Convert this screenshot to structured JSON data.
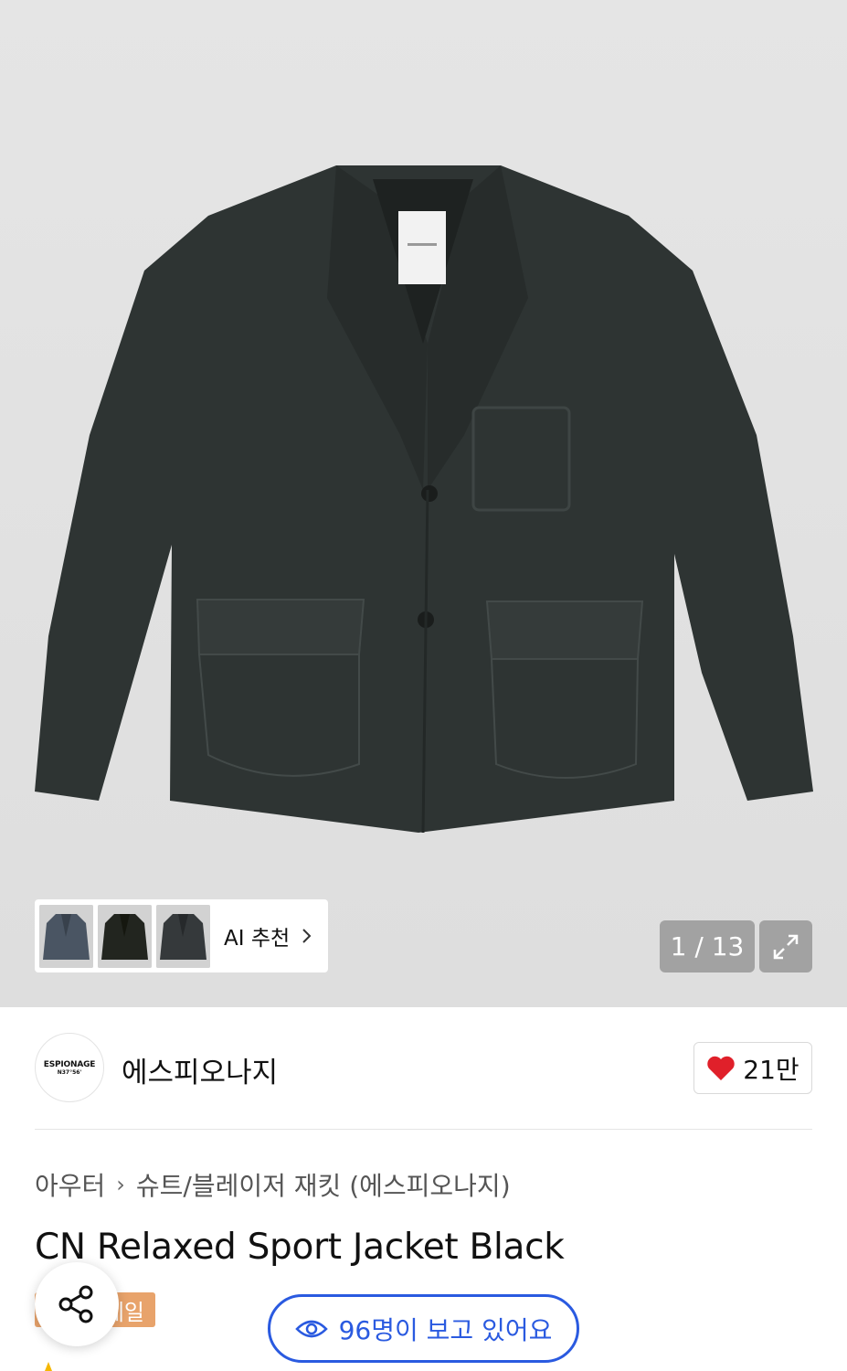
{
  "gallery": {
    "counter": "1 / 13",
    "ai_recommend_label": "AI 추천",
    "thumbnails": [
      "thumb-navy-jacket",
      "thumb-black-jacket",
      "thumb-charcoal-jacket"
    ]
  },
  "brand": {
    "logo_line1": "ESPIONAGE",
    "logo_line2": "N37°56'",
    "name": "에스피오나지",
    "likes": "21만"
  },
  "breadcrumb": {
    "level1": "아우터",
    "level2": "슈트/블레이저 재킷 (에스피오나지)"
  },
  "product": {
    "title": "CN Relaxed Sport Jacket Black",
    "badge": "세일"
  },
  "viewers": {
    "text": "96명이 보고 있어요"
  },
  "colors": {
    "accent_blue": "#2a5ae0",
    "sale_orange": "#e8a36b",
    "heart_red": "#e0202a"
  }
}
